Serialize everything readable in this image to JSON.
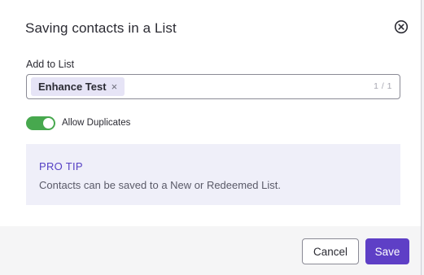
{
  "modal": {
    "title": "Saving contacts in a List"
  },
  "add_to_list": {
    "label": "Add to List",
    "selected_chip": "Enhance Test",
    "chip_remove_glyph": "×",
    "counter": "1 / 1"
  },
  "toggle": {
    "label": "Allow Duplicates",
    "on": true,
    "color": "#47a84e"
  },
  "tip": {
    "title": "PRO TIP",
    "body": "Contacts can be saved to a New or Redeemed List."
  },
  "footer": {
    "cancel_label": "Cancel",
    "save_label": "Save"
  },
  "colors": {
    "accent": "#5e3fc6",
    "tip_background": "#efeff9"
  },
  "icons": {
    "close": "close-circle-icon"
  }
}
